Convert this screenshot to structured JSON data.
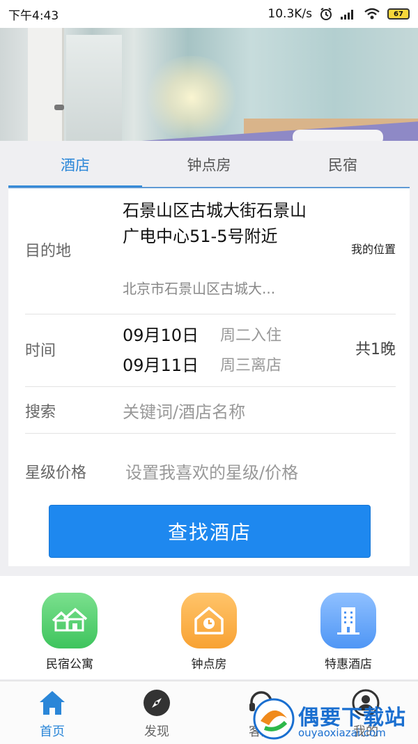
{
  "status_bar": {
    "time": "下午4:43",
    "net_speed": "10.3K/s",
    "battery": "67"
  },
  "banner": {
    "page_count": 3,
    "active_page": 2
  },
  "tabs": [
    {
      "label": "酒店",
      "active": true
    },
    {
      "label": "钟点房",
      "active": false
    },
    {
      "label": "民宿",
      "active": false
    }
  ],
  "form": {
    "destination": {
      "label": "目的地",
      "value": "石景山区古城大街石景山广电中心51-5号附近",
      "sub": "北京市石景山区古城大...",
      "my_location": "我的位置"
    },
    "time": {
      "label": "时间",
      "checkin_date": "09月10日",
      "checkin_note": "周二入住",
      "checkout_date": "09月11日",
      "checkout_note": "周三离店",
      "nights": "共1晚"
    },
    "search": {
      "label": "搜索",
      "placeholder": "关键词/酒店名称"
    },
    "star_price": {
      "label": "星级价格",
      "placeholder": "设置我喜欢的星级/价格"
    },
    "submit_label": "查找酒店"
  },
  "quick_links": [
    {
      "label": "民宿公寓",
      "icon": "house-icon",
      "color": "#3ec45d"
    },
    {
      "label": "钟点房",
      "icon": "clock-house-icon",
      "color": "#f8a233"
    },
    {
      "label": "特惠酒店",
      "icon": "building-icon",
      "color": "#4f96f5"
    }
  ],
  "bottom_nav": [
    {
      "label": "首页",
      "icon": "home-icon",
      "active": true
    },
    {
      "label": "发现",
      "icon": "compass-icon",
      "active": false
    },
    {
      "label": "客服",
      "icon": "headset-icon",
      "active": false
    },
    {
      "label": "我的",
      "icon": "user-icon",
      "active": false
    }
  ],
  "watermark": {
    "title": "偶要下载站",
    "url": "ouyaoxiazai.com"
  },
  "colors": {
    "accent": "#2a86d8",
    "button": "#1e88ef"
  }
}
